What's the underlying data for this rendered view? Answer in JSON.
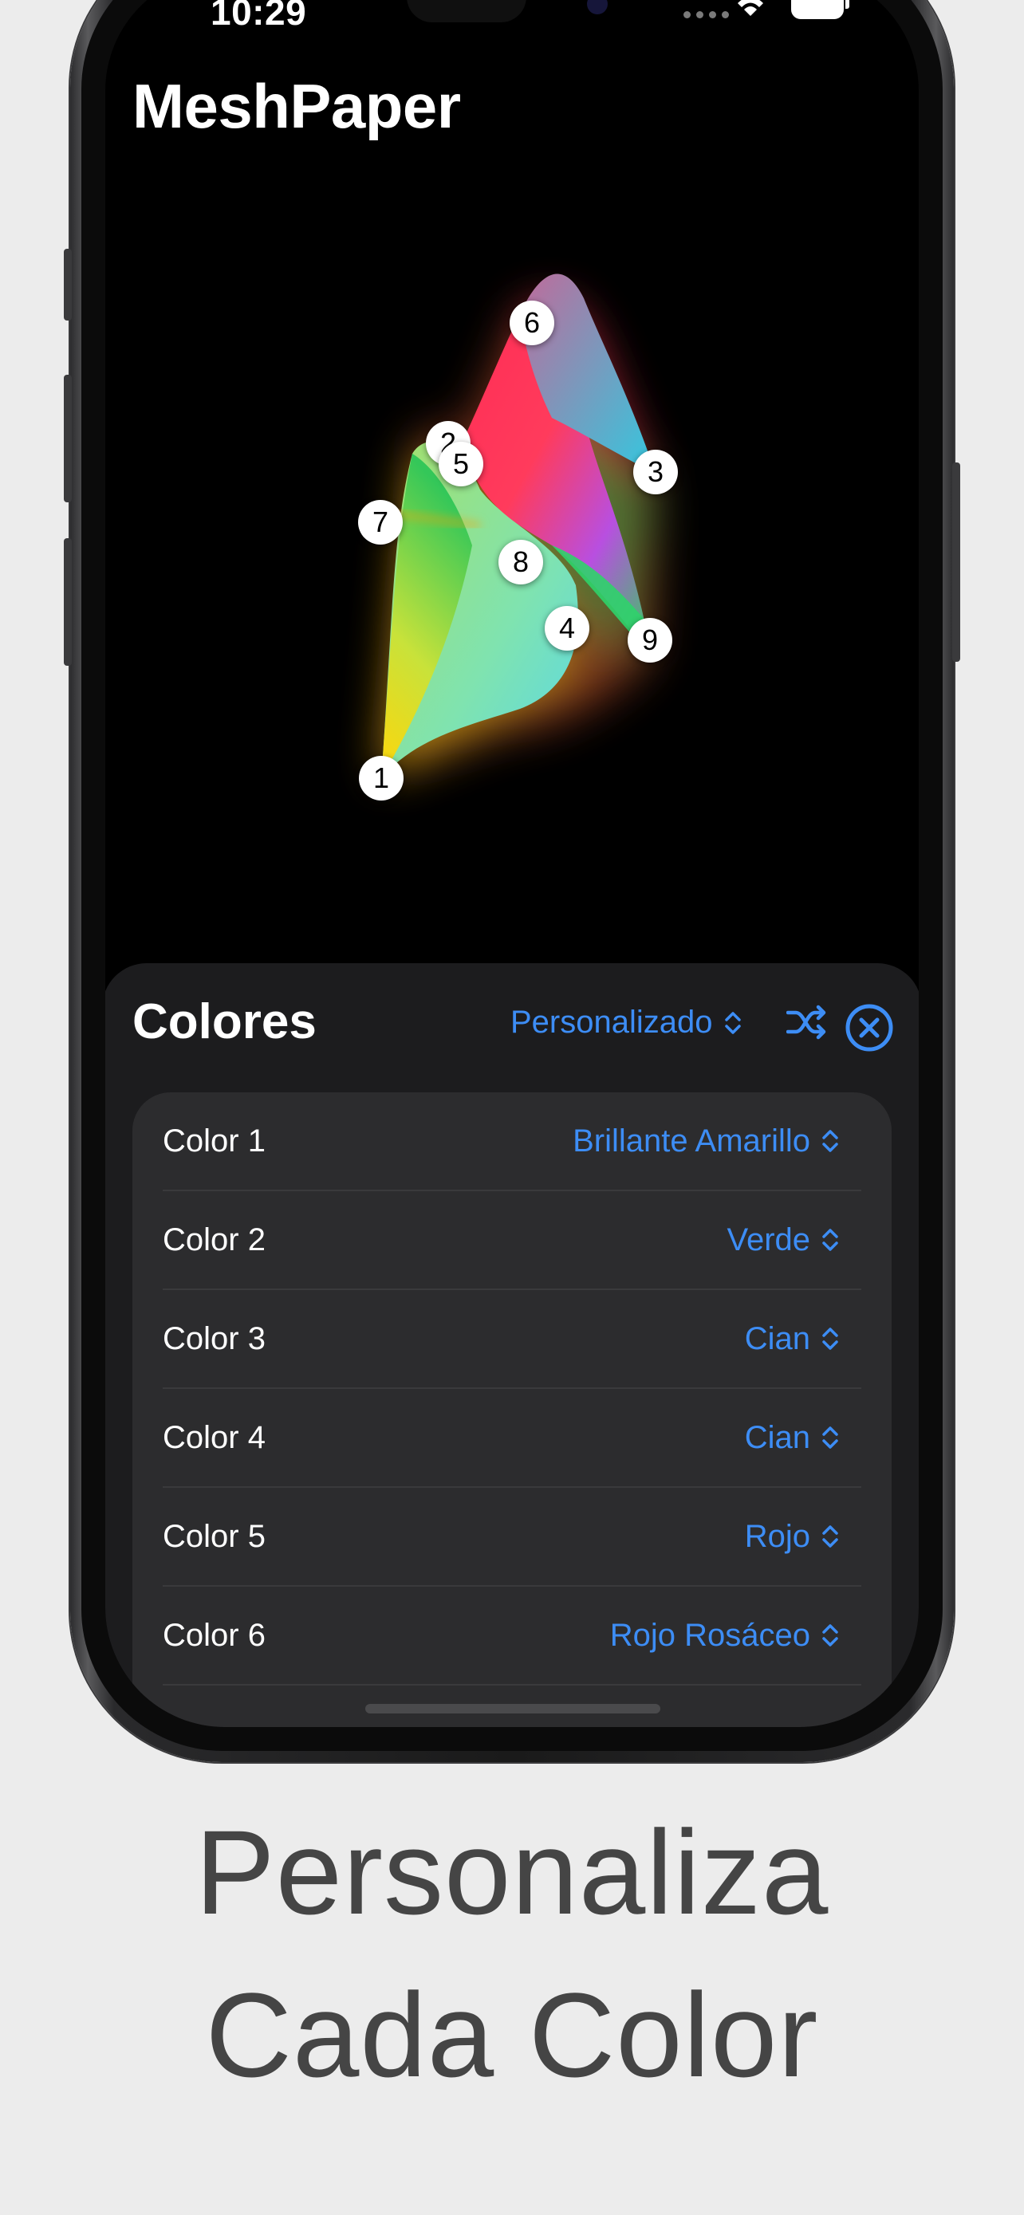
{
  "status_bar": {
    "time": "10:29"
  },
  "app": {
    "title": "MeshPaper"
  },
  "mesh": {
    "points": [
      "1",
      "2",
      "3",
      "4",
      "5",
      "6",
      "7",
      "8",
      "9"
    ]
  },
  "sheet": {
    "title": "Colores",
    "preset": "Personalizado",
    "colors": [
      {
        "label": "Color 1",
        "value": "Brillante Amarillo"
      },
      {
        "label": "Color 2",
        "value": "Verde"
      },
      {
        "label": "Color 3",
        "value": "Cian"
      },
      {
        "label": "Color 4",
        "value": "Cian"
      },
      {
        "label": "Color 5",
        "value": "Rojo"
      },
      {
        "label": "Color 6",
        "value": "Rojo Rosáceo"
      }
    ]
  },
  "caption": {
    "line1": "Personaliza",
    "line2": "Cada Color"
  },
  "theme": {
    "accent": "#3d8df5",
    "sheet_bg": "#1c1c1e",
    "list_bg": "#2c2c2e",
    "page_bg": "#ececec"
  }
}
